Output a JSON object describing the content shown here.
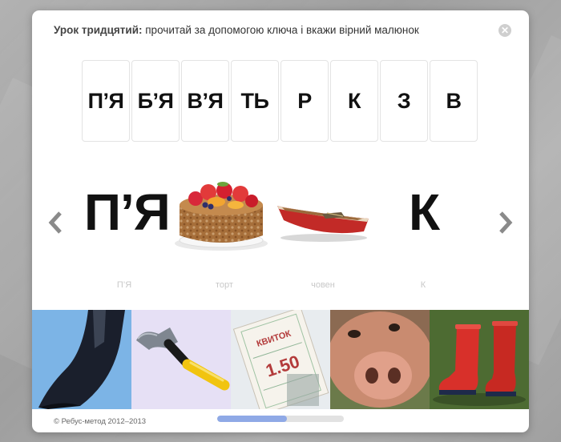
{
  "dialog": {
    "title_bold": "Урок тридцятий:",
    "title_rest": " прочитай за допомогою ключа і вкажи вірний малюнок",
    "close_icon": "close-icon"
  },
  "keys": [
    "П’Я",
    "Б’Я",
    "В’Я",
    "ТЬ",
    "Р",
    "К",
    "З",
    "В"
  ],
  "rebus": {
    "prev_icon": "chevron-left-icon",
    "next_icon": "chevron-right-icon",
    "items": [
      {
        "type": "text",
        "text": "П’Я",
        "caption": "П’Я"
      },
      {
        "type": "image",
        "image": "cake-icon",
        "caption": "торт"
      },
      {
        "type": "image",
        "image": "boat-icon",
        "caption": "човен"
      },
      {
        "type": "text",
        "text": "К",
        "caption": "К"
      }
    ]
  },
  "answers": [
    {
      "image": "hoof-icon"
    },
    {
      "image": "hammer-icon"
    },
    {
      "image": "ticket-icon",
      "label": "КВИТОК",
      "price": "1.50"
    },
    {
      "image": "pig-snout-icon"
    },
    {
      "image": "red-boots-icon"
    }
  ],
  "footer": {
    "copyright": "© Ребус-метод 2012–2013",
    "progress_fraction": 0.55
  },
  "colors": {
    "progress": "#8fa9e6",
    "hoof_bg": "#7cb4e6",
    "hammer_bg": "#e6e0f5",
    "boots_bg": "#4d6b32"
  }
}
